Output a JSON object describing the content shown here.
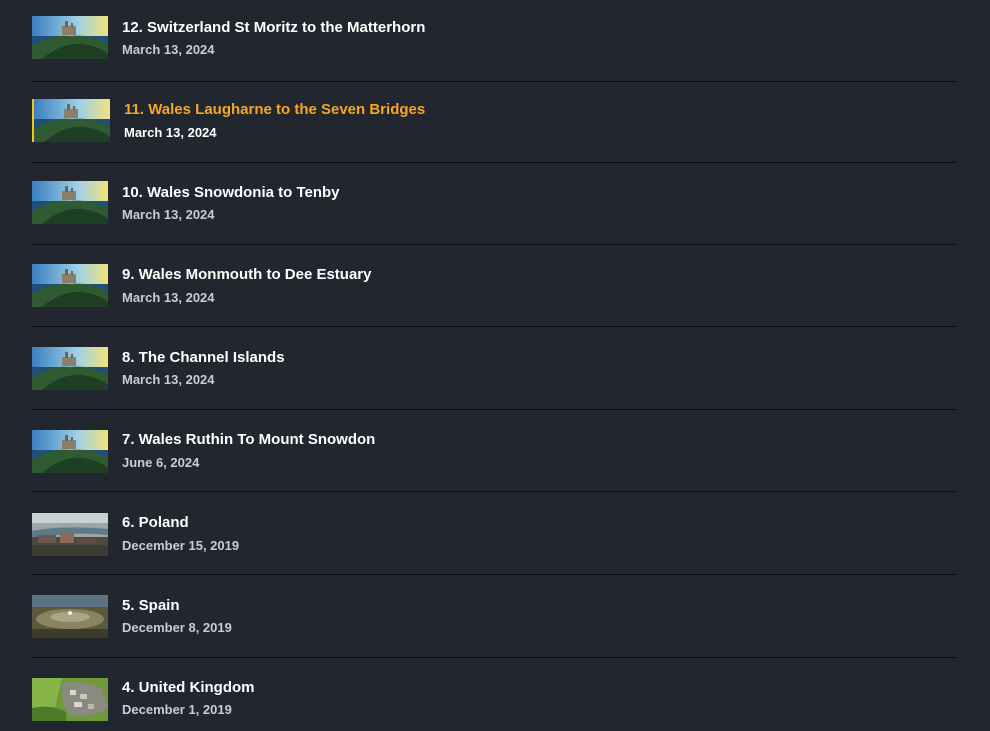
{
  "episodes": [
    {
      "title": "12. Switzerland St Moritz to the Matterhorn",
      "date": "March 13, 2024",
      "thumb": "castle-hill",
      "active": false
    },
    {
      "title": "11. Wales Laugharne to the Seven Bridges",
      "date": "March 13, 2024",
      "thumb": "castle-hill",
      "active": true
    },
    {
      "title": "10. Wales Snowdonia to Tenby",
      "date": "March 13, 2024",
      "thumb": "castle-hill",
      "active": false
    },
    {
      "title": "9. Wales Monmouth to Dee Estuary",
      "date": "March 13, 2024",
      "thumb": "castle-hill",
      "active": false
    },
    {
      "title": "8. The Channel Islands",
      "date": "March 13, 2024",
      "thumb": "castle-hill",
      "active": false
    },
    {
      "title": "7. Wales Ruthin To Mount Snowdon",
      "date": "June 6, 2024",
      "thumb": "castle-hill",
      "active": false
    },
    {
      "title": "6. Poland",
      "date": "December 15, 2019",
      "thumb": "aerial-town-river",
      "active": false
    },
    {
      "title": "5. Spain",
      "date": "December 8, 2019",
      "thumb": "aerial-plain-circle",
      "active": false
    },
    {
      "title": "4. United Kingdom",
      "date": "December 1, 2019",
      "thumb": "aerial-village-green",
      "active": false
    }
  ],
  "colors": {
    "background": "#22262e",
    "active_title": "#f5a623",
    "active_marker": "#f5c518"
  }
}
